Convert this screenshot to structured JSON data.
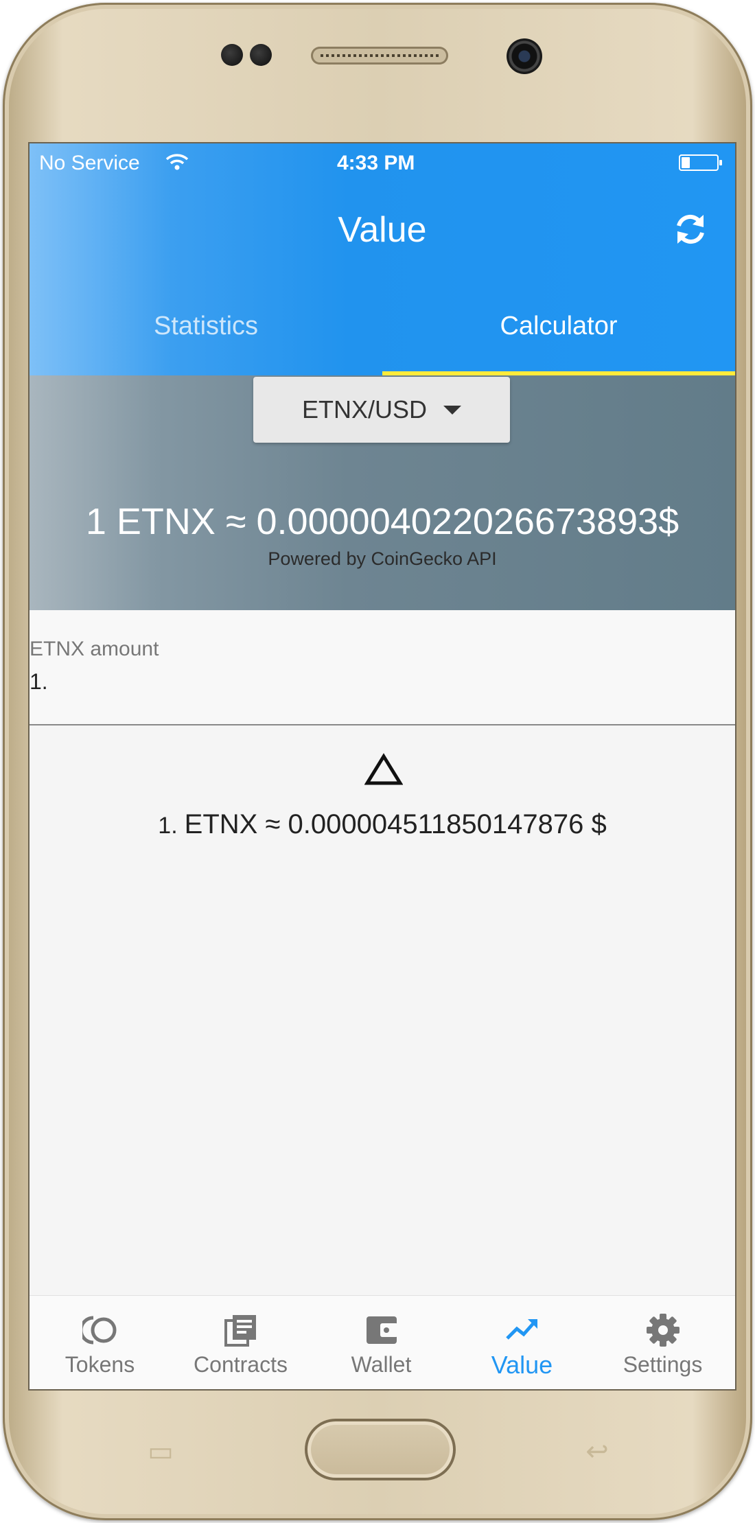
{
  "status_bar": {
    "carrier": "No Service",
    "time": "4:33 PM"
  },
  "header": {
    "title": "Value"
  },
  "tabs": [
    {
      "label": "Statistics",
      "active": false
    },
    {
      "label": "Calculator",
      "active": true
    }
  ],
  "rate_panel": {
    "pair": "ETNX/USD",
    "rate": "1 ETNX ≈ 0.000004022026673893$",
    "powered_by": "Powered by CoinGecko API"
  },
  "input": {
    "label": "ETNX amount",
    "value": "1."
  },
  "result": {
    "amount": "1.",
    "text": "ETNX ≈ 0.000004511850147876 $"
  },
  "bottom_nav": [
    {
      "label": "Tokens",
      "icon": "tokens-icon",
      "active": false
    },
    {
      "label": "Contracts",
      "icon": "contracts-icon",
      "active": false
    },
    {
      "label": "Wallet",
      "icon": "wallet-icon",
      "active": false
    },
    {
      "label": "Value",
      "icon": "trending-up-icon",
      "active": true
    },
    {
      "label": "Settings",
      "icon": "gear-icon",
      "active": false
    }
  ],
  "colors": {
    "primary": "#2196f3",
    "tab_indicator": "#ffeb3b",
    "rate_panel": "#627c89"
  }
}
